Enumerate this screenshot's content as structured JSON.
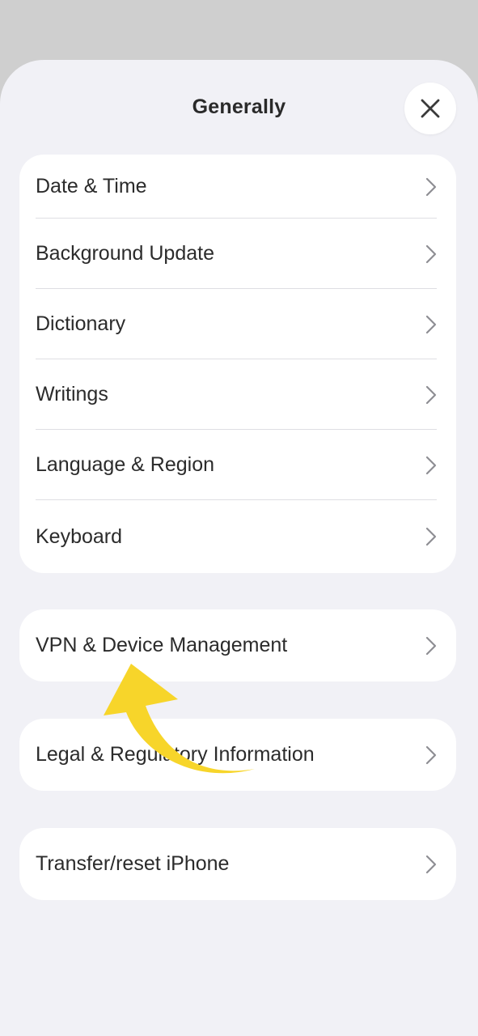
{
  "header": {
    "title": "Generally",
    "close_icon": "close-icon"
  },
  "group_main": {
    "items": [
      {
        "label": "Date & Time"
      },
      {
        "label": "Background Update"
      },
      {
        "label": "Dictionary"
      },
      {
        "label": "Writings"
      },
      {
        "label": "Language & Region"
      },
      {
        "label": "Keyboard"
      }
    ]
  },
  "vpn": {
    "label": "VPN & Device Management"
  },
  "legal": {
    "label": "Legal & Regulatory Information"
  },
  "transfer": {
    "label": "Transfer/reset iPhone"
  },
  "colors": {
    "sheet_background": "#f1f1f6",
    "card_background": "#ffffff",
    "arrow_annotation": "#f7d52a",
    "chevron": "#8e8e93"
  }
}
